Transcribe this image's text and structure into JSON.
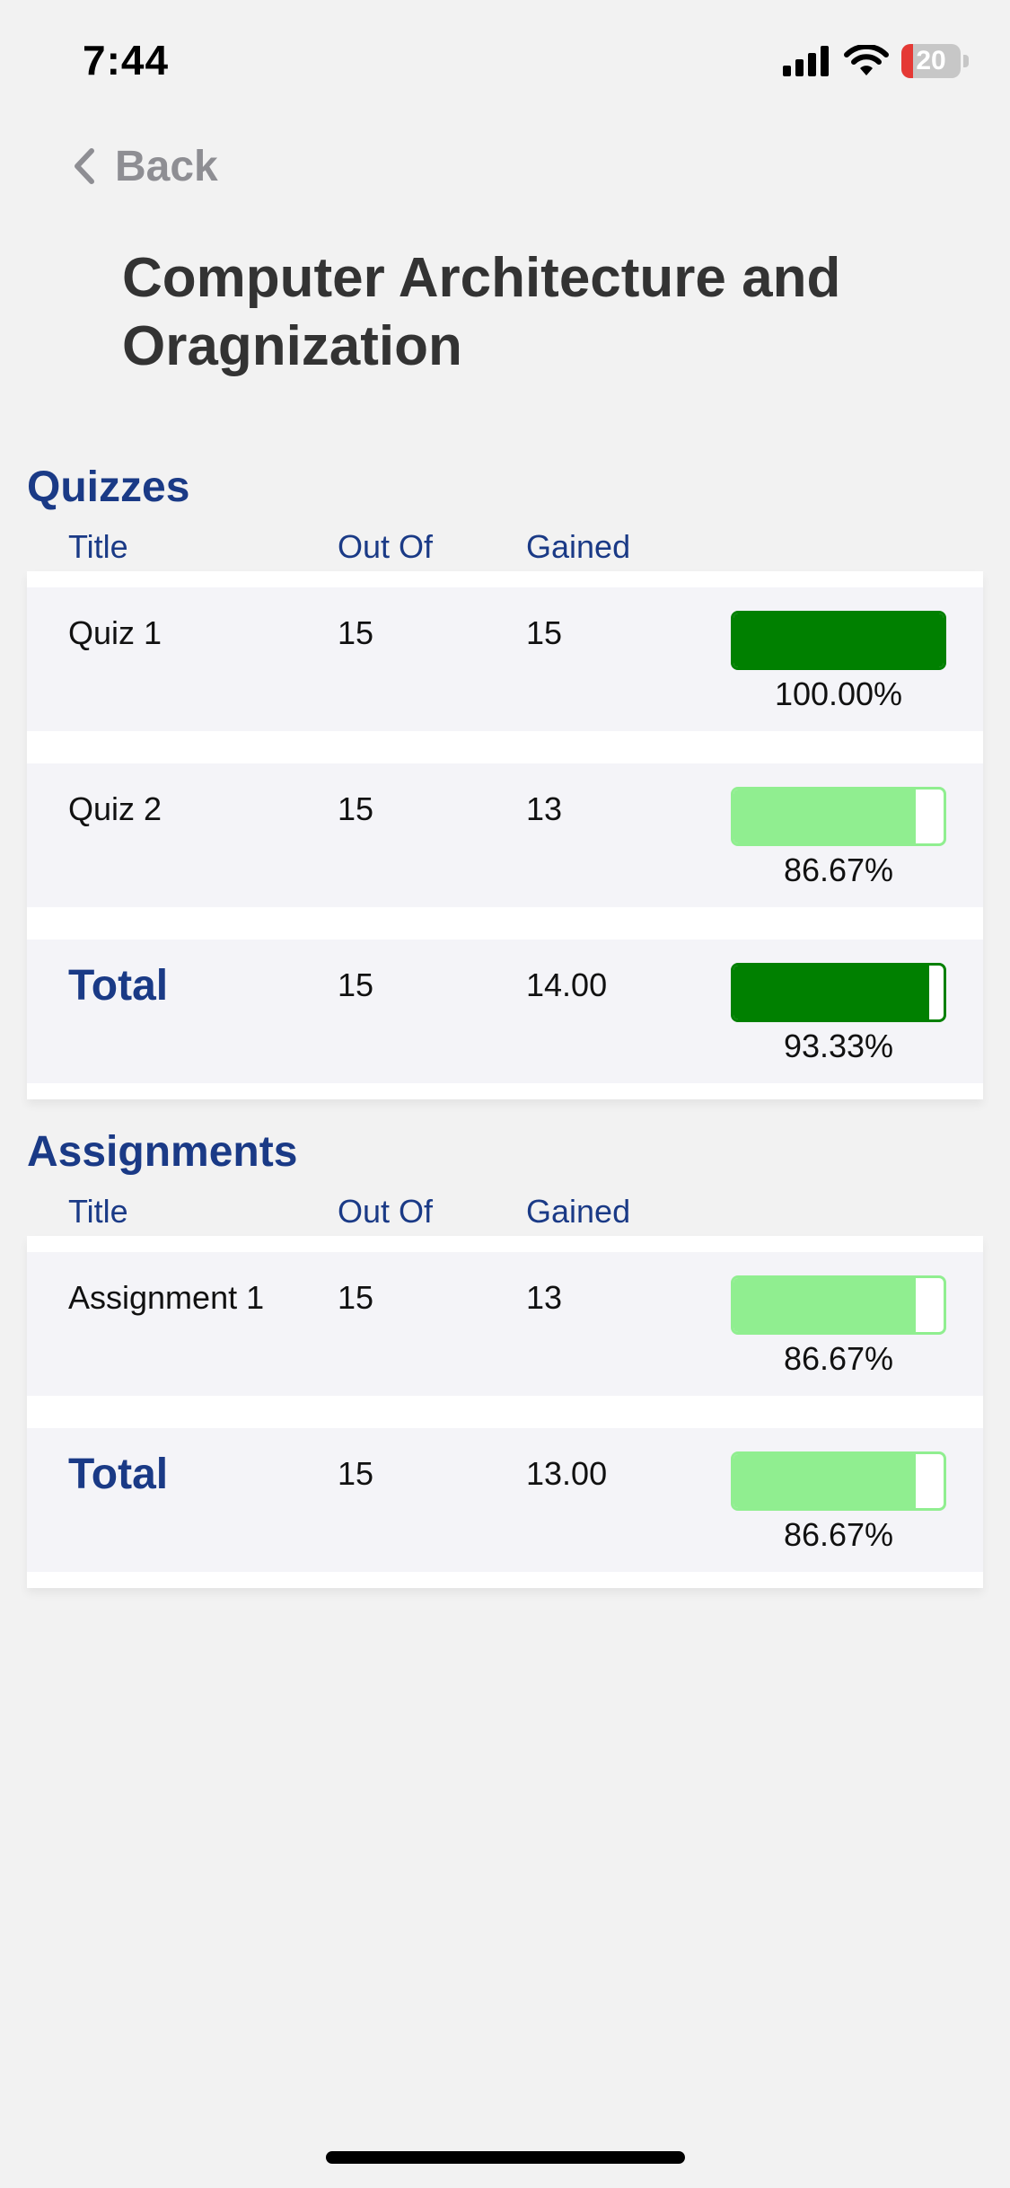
{
  "status_bar": {
    "time": "7:44",
    "battery": "20",
    "battery_color": "#e53935"
  },
  "nav": {
    "back_label": "Back"
  },
  "page": {
    "title": "Computer Architecture and Oragnization"
  },
  "colors": {
    "dark_green": "#008000",
    "light_green": "#90ee90",
    "header_blue": "#1a3a86"
  },
  "quizzes": {
    "title": "Quizzes",
    "columns": [
      "Title",
      "Out Of",
      "Gained"
    ],
    "rows": [
      {
        "title": "Quiz 1",
        "out_of": "15",
        "gained": "15",
        "percent": "100.00%",
        "fraction": 1.0,
        "color": "#008000",
        "is_total": false
      },
      {
        "title": "Quiz 2",
        "out_of": "15",
        "gained": "13",
        "percent": "86.67%",
        "fraction": 0.8667,
        "color": "#90ee90",
        "is_total": false
      },
      {
        "title": "Total",
        "out_of": "15",
        "gained": "14.00",
        "percent": "93.33%",
        "fraction": 0.9333,
        "color": "#008000",
        "is_total": true
      }
    ]
  },
  "assignments": {
    "title": "Assignments",
    "columns": [
      "Title",
      "Out Of",
      "Gained"
    ],
    "rows": [
      {
        "title": "Assignment 1",
        "out_of": "15",
        "gained": "13",
        "percent": "86.67%",
        "fraction": 0.8667,
        "color": "#90ee90",
        "is_total": false
      },
      {
        "title": "Total",
        "out_of": "15",
        "gained": "13.00",
        "percent": "86.67%",
        "fraction": 0.8667,
        "color": "#90ee90",
        "is_total": true
      }
    ]
  }
}
